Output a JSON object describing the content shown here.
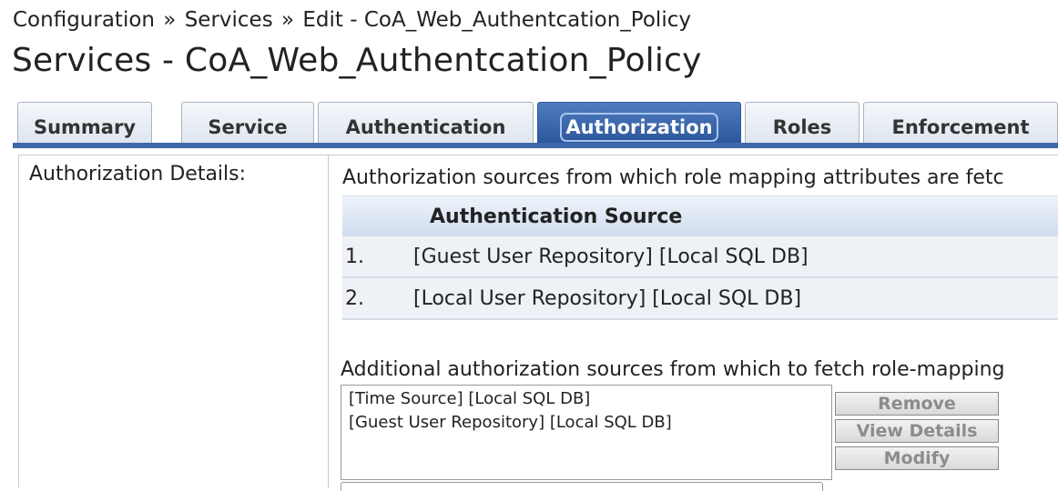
{
  "breadcrumb": {
    "items": [
      "Configuration",
      "Services",
      "Edit - CoA_Web_Authentcation_Policy"
    ],
    "separator": "»"
  },
  "page": {
    "title": "Services - CoA_Web_Authentcation_Policy"
  },
  "tabs": [
    {
      "label": "Summary",
      "active": false
    },
    {
      "label": "Service",
      "active": false
    },
    {
      "label": "Authentication",
      "active": false
    },
    {
      "label": "Authorization",
      "active": true
    },
    {
      "label": "Roles",
      "active": false
    },
    {
      "label": "Enforcement",
      "active": false
    }
  ],
  "authorization": {
    "details_label": "Authorization Details:",
    "intro_text": "Authorization sources from which role mapping attributes are fetc",
    "table": {
      "header": "Authentication Source",
      "rows": [
        {
          "num": "1.",
          "source": "[Guest User Repository] [Local SQL DB]"
        },
        {
          "num": "2.",
          "source": "[Local User Repository] [Local SQL DB]"
        }
      ]
    },
    "additional_text": "Additional authorization sources from which to fetch role-mapping",
    "additional_sources": [
      "[Time Source] [Local SQL DB]",
      "[Guest User Repository] [Local SQL DB]"
    ],
    "buttons": {
      "remove": "Remove",
      "view_details": "View Details",
      "modify": "Modify"
    }
  },
  "colors": {
    "active_tab": "#3e68a9",
    "tab_bg": "#dfe6ef",
    "table_header": "#cfdcee",
    "disabled_button_text": "#8c8c8c"
  }
}
